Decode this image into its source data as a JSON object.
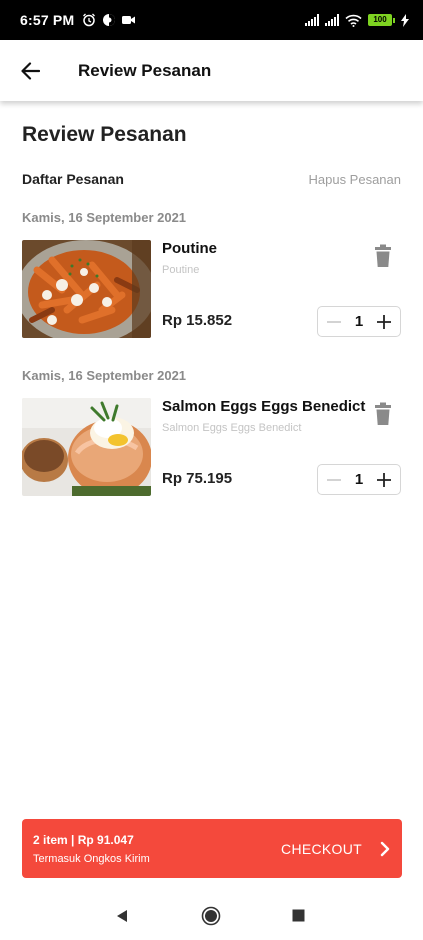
{
  "status_bar": {
    "time": "6:57 PM",
    "battery": "100",
    "icons": [
      "alarm-icon",
      "data-saver-icon",
      "video-icon",
      "signal-icon",
      "signal-icon",
      "wifi-icon",
      "battery-icon",
      "charging-icon"
    ]
  },
  "app_bar": {
    "back_icon": "arrow-left-icon",
    "title": "Review Pesanan"
  },
  "page": {
    "title": "Review Pesanan",
    "list_label": "Daftar Pesanan",
    "clear_label": "Hapus Pesanan"
  },
  "orders": [
    {
      "date": "Kamis, 16 September 2021",
      "name": "Poutine",
      "description": "Poutine",
      "price": "Rp 15.852",
      "quantity": "1",
      "image": "poutine-photo"
    },
    {
      "date": "Kamis, 16 September 2021",
      "name": "Salmon Eggs Eggs Benedict",
      "description": "Salmon Eggs Eggs Benedict",
      "price": "Rp 75.195",
      "quantity": "1",
      "image": "eggs-benedict-photo"
    }
  ],
  "checkout": {
    "summary": "2 item | Rp 91.047",
    "note": "Termasuk Ongkos Kirim",
    "label": "CHECKOUT",
    "color": "#f4493c"
  },
  "nav_bar": {
    "icons": [
      "back-triangle-icon",
      "home-circle-icon",
      "recents-square-icon"
    ]
  }
}
